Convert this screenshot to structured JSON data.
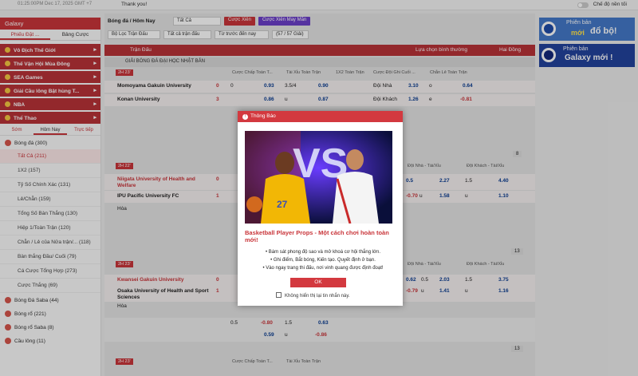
{
  "topbar": {
    "time": "01:25:00PM Dec 17, 2025 GMT +7",
    "message": "Thank you!",
    "dark_mode": "Chế độ nền tối"
  },
  "sidebar": {
    "header": "Galaxy",
    "tabs": [
      "Phiếu Đặt ...",
      "Bảng Cược"
    ],
    "categories": [
      "Vô Địch Thế Giới",
      "Thế Vận Hội Mùa Đông",
      "SEA Games",
      "Giải Cầu lông Bật hùng T...",
      "NBA",
      "Thể Thao"
    ],
    "sub_tabs": [
      "Sớm",
      "Hôm Nay",
      "Trực tiếp"
    ],
    "sports": [
      {
        "label": "Bóng đá",
        "count": "(300)"
      }
    ],
    "bet_types": [
      "Tất Cả (211)",
      "1X2 (157)",
      "Tỷ Số Chính Xác (131)",
      "Lẻ/Chẵn (159)",
      "Tổng Số Bàn Thắng (130)",
      "Hiệp 1/Toàn Trận (120)",
      "Chẵn / Lẻ của Nửa trận/... (118)",
      "Bàn thắng Đầu/ Cuối (79)",
      "Cá Cược Tổng Hợp (273)",
      "Cược Thắng (69)"
    ],
    "other_sports": [
      "Bóng Đá Saba (44)",
      "Bóng rổ (221)",
      "Bóng rổ Saba (8)",
      "Cầu lông (11)"
    ]
  },
  "filters": {
    "breadcrumb": "Bóng đá / Hôm Nay",
    "all": "Tất Cả",
    "bet_btn": "Cược Xiên",
    "lucky_btn": "Cược Xiên May Mắn",
    "league_filter": "Bộ Lọc Trận Đấu",
    "all_matches": "Tất cả trận đấu",
    "sort": "Từ trước đến nay",
    "count": "(57 / 57 Giải)"
  },
  "table": {
    "match_col": "Trận Đấu",
    "odds_type": "Lựa chọn bình thường",
    "two_way": "Hai Đồng",
    "league": "GIẢI BÓNG ĐÁ ĐẠI HỌC NHẬT BẢN",
    "headers": [
      "Cược Chấp Toàn T...",
      "Tài Xỉu Toàn Trận",
      "1X2 Toàn Trận",
      "Cược Đội Ghi Cuối ...",
      "Chẵn Lẻ Toàn Trận"
    ],
    "headers2": [
      "Cược Chấp Toàn T...",
      "Tài Xỉu Toàn Trận",
      "Đội Nhà - Tài/Xỉu",
      "Đội Khách - Tài/Xỉu"
    ],
    "more1": "8",
    "more2": "13",
    "more3": "13"
  },
  "matches": [
    {
      "time": "2H 23'",
      "home": "Momoyama Gakuin University",
      "away": "Konan University",
      "hs": "0",
      "as": "3",
      "r1": [
        "0",
        "0.93",
        "3.5/4",
        "0.90",
        "Đội Nhà",
        "3.10",
        "o",
        "0.64"
      ],
      "r2": [
        "",
        "0.86",
        "u",
        "0.87",
        "Đội Khách",
        "1.26",
        "e",
        "-0.81"
      ]
    },
    {
      "time": "2H 22'",
      "home": "Niigata University of Health and Welfare",
      "away": "IPU Pacific University FC",
      "draw": "Hòa",
      "hs": "0",
      "as": "1",
      "r1": [
        "0.5",
        "1.25",
        "0.5",
        "2.27",
        "1.5",
        "4.40"
      ],
      "r2": [
        "-0.70",
        "u",
        "1.58",
        "u",
        "1.10"
      ]
    },
    {
      "time": "2H 23'",
      "home": "Kwansei Gakuin University",
      "away": "Osaka University of Health and Sport Sciences",
      "draw": "Hòa",
      "hs": "0",
      "as": "1",
      "r1": [
        "0.62",
        "0.5",
        "2.03",
        "1.5",
        "3.75"
      ],
      "r2": [
        "-0.79",
        "u",
        "1.41",
        "u",
        "1.16"
      ],
      "r3": [
        "0.5",
        "-0.80",
        "1.5",
        "0.63"
      ],
      "r4": [
        "",
        "0.59",
        "u",
        "-0.86"
      ]
    },
    {
      "time": "2H 23'"
    }
  ],
  "modal": {
    "title": "Thông Báo",
    "headline": "Basketball Player Props - Một cách chơi hoàn toàn mới!",
    "bullets": [
      "Bám sát phong độ sao và mở khoá cơ hội thắng lớn.",
      "Ghi điểm, Bắt bóng, Kiến tạo. Quyết định ở bạn.",
      "Vào ngay trang thi đấu, nơi vinh quang được định đoạt!"
    ],
    "ok": "OK",
    "no_show": "Không hiển thị lại tin nhắn này.",
    "vs": "VS",
    "jersey": "27"
  },
  "banners": [
    {
      "line1": "Phiên bản",
      "line2": "đổ bộ!",
      "tag": "mới"
    },
    {
      "line1": "Phiên bản",
      "line2": "Galaxy mới !"
    }
  ],
  "colors": {
    "brand_red": "#c9353a",
    "accent_purple": "#6b3fc8",
    "navy": "#0b3d91"
  }
}
